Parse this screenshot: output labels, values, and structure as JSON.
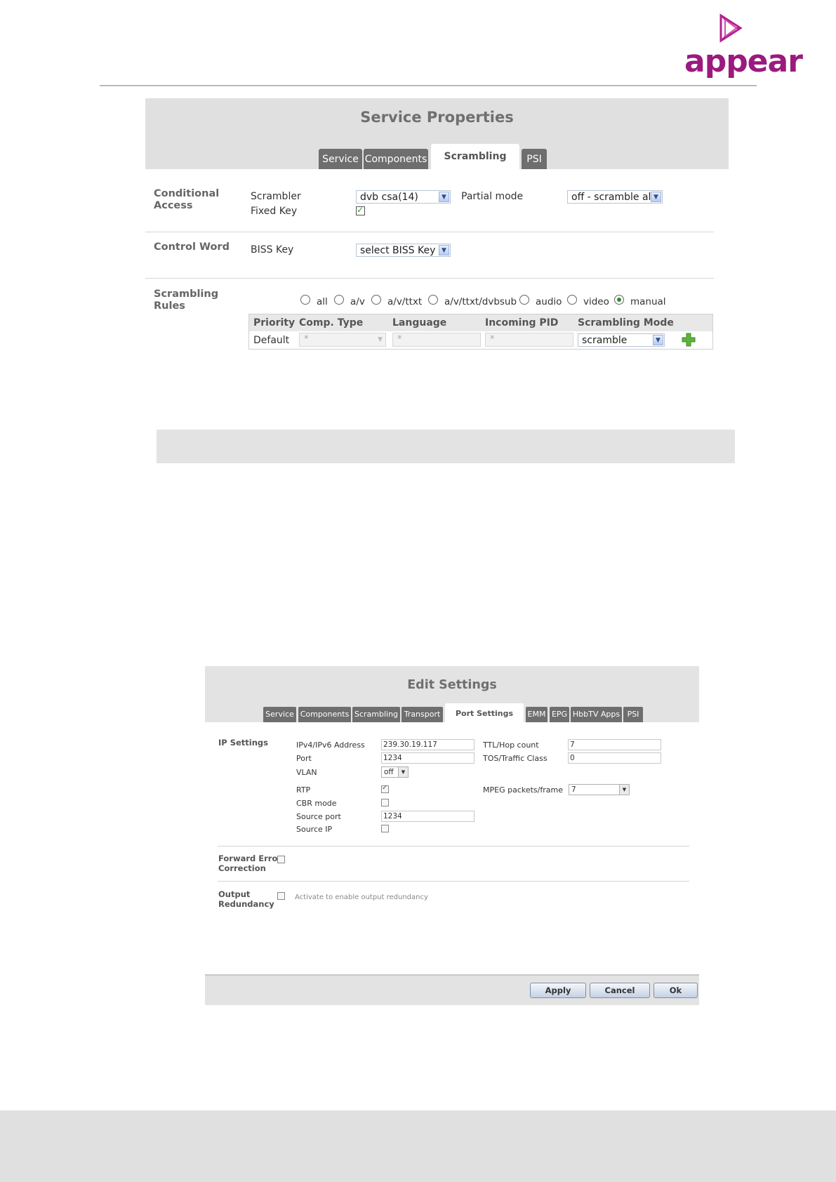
{
  "brand": {
    "name": "appear",
    "color": "#9b1a7e"
  },
  "panel1": {
    "title": "Service Properties",
    "tabs": [
      "Service",
      "Components",
      "Scrambling",
      "PSI"
    ],
    "active_tab": "Scrambling",
    "conditional_access": {
      "section": "Conditional\nAccess",
      "scrambler_label": "Scrambler",
      "scrambler_value": "dvb csa(14)",
      "partial_mode_label": "Partial mode",
      "partial_mode_value": "off - scramble all",
      "fixed_key_label": "Fixed Key",
      "fixed_key_checked": true
    },
    "control_word": {
      "section": "Control Word",
      "biss_label": "BISS Key",
      "biss_value": "select BISS Key"
    },
    "scrambling_rules": {
      "section": "Scrambling\nRules",
      "options": [
        "all",
        "a/v",
        "a/v/ttxt",
        "a/v/ttxt/dvbsub",
        "audio",
        "video",
        "manual"
      ],
      "selected": "manual",
      "columns": [
        "Priority",
        "Comp. Type",
        "Language",
        "Incoming PID",
        "Scrambling Mode"
      ],
      "row": {
        "priority": "Default",
        "comp_type": "*",
        "language": "*",
        "pid": "*",
        "mode": "scramble"
      }
    }
  },
  "panel2": {
    "title": "Edit Settings",
    "tabs": [
      "Service",
      "Components",
      "Scrambling",
      "Transport",
      "Port Settings",
      "EMM",
      "EPG",
      "HbbTV Apps",
      "PSI"
    ],
    "active_tab": "Port Settings",
    "ip_settings": {
      "section": "IP Settings",
      "address_label": "IPv4/IPv6 Address",
      "address_value": "239.30.19.117",
      "port_label": "Port",
      "port_value": "1234",
      "vlan_label": "VLAN",
      "vlan_value": "off",
      "ttl_label": "TTL/Hop count",
      "ttl_value": "7",
      "tos_label": "TOS/Traffic Class",
      "tos_value": "0",
      "rtp_label": "RTP",
      "rtp_checked": true,
      "mpeg_label": "MPEG packets/frame",
      "mpeg_value": "7",
      "cbr_label": "CBR mode",
      "source_port_label": "Source port",
      "source_port_value": "1234",
      "source_ip_label": "Source IP"
    },
    "fec": {
      "section": "Forward Error\nCorrection"
    },
    "redundancy": {
      "section": "Output\nRedundancy",
      "hint": "Activate to enable output redundancy"
    },
    "buttons": {
      "apply": "Apply",
      "cancel": "Cancel",
      "ok": "Ok"
    }
  }
}
